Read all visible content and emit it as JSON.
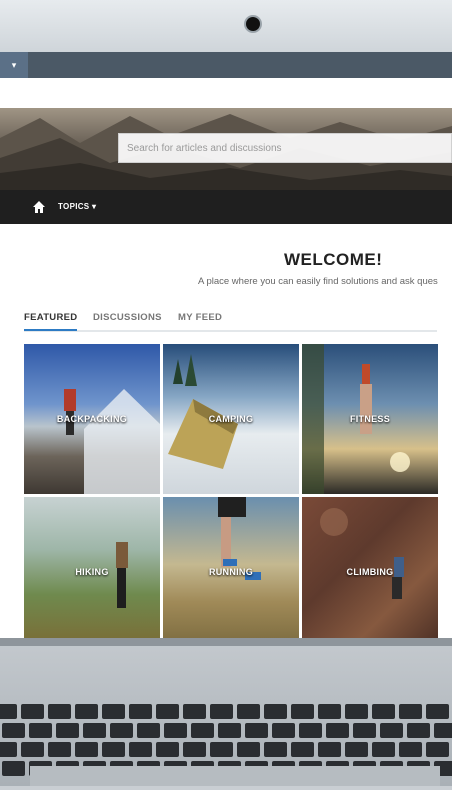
{
  "header": {
    "menu_icon": "chevron-down-icon"
  },
  "hero": {
    "search_placeholder": "Search for articles and discussions"
  },
  "nav": {
    "home_icon": "home-icon",
    "topics_label": "TOPICS"
  },
  "welcome": {
    "title": "WELCOME!",
    "subtitle": "A place where you can easily find solutions and ask ques"
  },
  "tabs": [
    {
      "label": "FEATURED",
      "active": true
    },
    {
      "label": "DISCUSSIONS",
      "active": false
    },
    {
      "label": "MY FEED",
      "active": false
    }
  ],
  "topics": [
    {
      "label": "BACKPACKING"
    },
    {
      "label": "CAMPING"
    },
    {
      "label": "FITNESS"
    },
    {
      "label": "HIKING"
    },
    {
      "label": "RUNNING"
    },
    {
      "label": "CLIMBING"
    }
  ],
  "colors": {
    "accent": "#2d7bc4",
    "app_bar": "#4b5966",
    "nav_bar": "#1f1f1f"
  }
}
